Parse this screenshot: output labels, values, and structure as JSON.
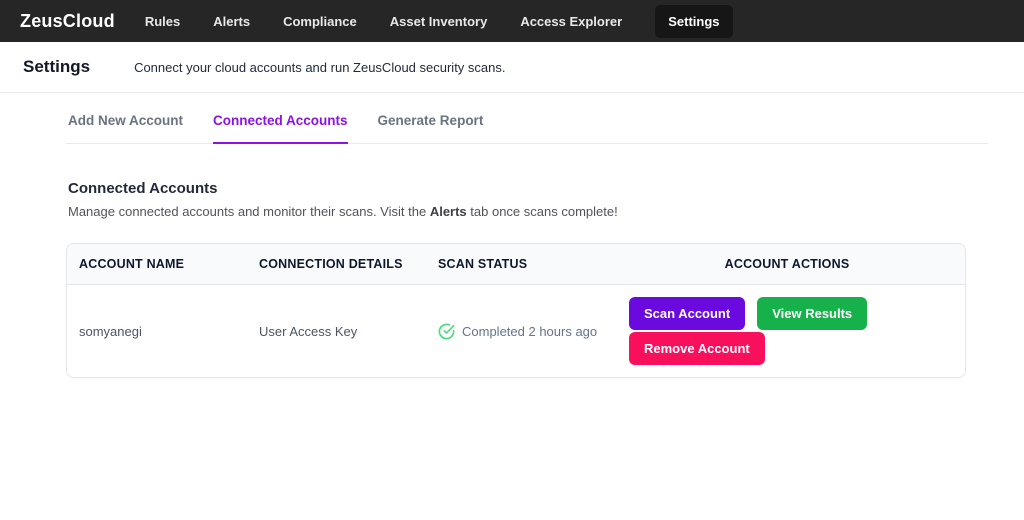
{
  "brand": "ZeusCloud",
  "navbar": {
    "items": [
      {
        "label": "Rules",
        "active": false
      },
      {
        "label": "Alerts",
        "active": false
      },
      {
        "label": "Compliance",
        "active": false
      },
      {
        "label": "Asset Inventory",
        "active": false
      },
      {
        "label": "Access Explorer",
        "active": false
      },
      {
        "label": "Settings",
        "active": true
      }
    ]
  },
  "header": {
    "title": "Settings",
    "subtitle": "Connect your cloud accounts and run ZeusCloud security scans."
  },
  "tabs": [
    {
      "label": "Add New Account",
      "active": false
    },
    {
      "label": "Connected Accounts",
      "active": true
    },
    {
      "label": "Generate Report",
      "active": false
    }
  ],
  "section": {
    "title": "Connected Accounts",
    "description_prefix": "Manage connected accounts and monitor their scans. Visit the ",
    "description_bold": "Alerts",
    "description_suffix": " tab once scans complete!"
  },
  "table": {
    "headers": [
      "ACCOUNT NAME",
      "CONNECTION DETAILS",
      "SCAN STATUS",
      "ACCOUNT ACTIONS"
    ],
    "rows": [
      {
        "account_name": "somyanegi",
        "connection_details": "User Access Key",
        "scan_status": "Completed 2 hours ago",
        "status_icon": "check-circle",
        "actions": {
          "scan": "Scan Account",
          "view": "View Results",
          "remove": "Remove Account"
        }
      }
    ]
  },
  "colors": {
    "navbar_bg": "#262626",
    "nav_active_bg": "#161616",
    "tab_active": "#8d12e3",
    "btn_scan": "#6b0ade",
    "btn_view": "#16b14a",
    "btn_remove": "#f8105c",
    "status_green": "#4ade80"
  }
}
